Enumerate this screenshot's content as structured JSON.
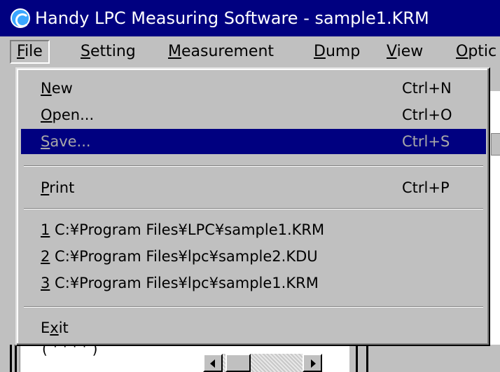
{
  "window": {
    "title": "Handy LPC Measuring Software - sample1.KRM",
    "icon": "app-logo-icon"
  },
  "menubar": {
    "items": [
      {
        "pre": "",
        "mn": "F",
        "post": "ile"
      },
      {
        "pre": "",
        "mn": "S",
        "post": "etting"
      },
      {
        "pre": "",
        "mn": "M",
        "post": "easurement"
      },
      {
        "pre": "",
        "mn": "D",
        "post": "ump"
      },
      {
        "pre": "",
        "mn": "V",
        "post": "iew"
      },
      {
        "pre": "",
        "mn": "O",
        "post": "ptic"
      }
    ]
  },
  "file_menu": {
    "new": {
      "pre": "",
      "mn": "N",
      "post": "ew",
      "shortcut": "Ctrl+N"
    },
    "open": {
      "pre": "",
      "mn": "O",
      "post": "pen...",
      "shortcut": "Ctrl+O"
    },
    "save": {
      "pre": "",
      "mn": "S",
      "post": "ave...",
      "shortcut": "Ctrl+S"
    },
    "print": {
      "pre": "",
      "mn": "P",
      "post": "rint",
      "shortcut": "Ctrl+P"
    },
    "recent": [
      {
        "mn": "1",
        "path": " C:¥Program Files¥LPC¥sample1.KRM"
      },
      {
        "mn": "2",
        "path": " C:¥Program Files¥lpc¥sample2.KDU"
      },
      {
        "mn": "3",
        "path": " C:¥Program Files¥lpc¥sample1.KRM"
      }
    ],
    "exit": {
      "pre": "E",
      "mn": "x",
      "post": "it"
    }
  },
  "background": {
    "partial_text": "( ' ' ' ' )"
  }
}
